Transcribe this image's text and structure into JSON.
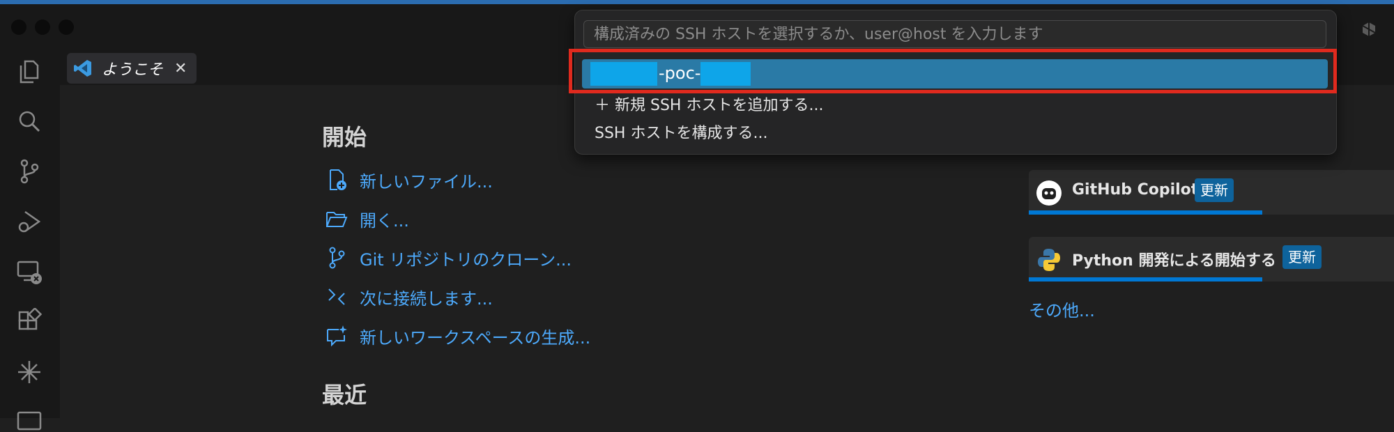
{
  "tab": {
    "label": "ようこそ",
    "close": "✕"
  },
  "quick_pick": {
    "placeholder": "構成済みの SSH ホストを選択するか、user@host を入力します",
    "selected_host": "-poc-",
    "items": [
      {
        "label": "＋ 新規 SSH ホストを追加する..."
      },
      {
        "label": "SSH ホストを構成する..."
      }
    ]
  },
  "start": {
    "title": "開始",
    "items": [
      {
        "label": "新しいファイル...",
        "icon": "new-file-icon"
      },
      {
        "label": "開く...",
        "icon": "folder-open-icon"
      },
      {
        "label": "Git リポジトリのクローン...",
        "icon": "source-control-icon"
      },
      {
        "label": "次に接続します...",
        "icon": "remote-connect-icon"
      },
      {
        "label": "新しいワークスペースの生成...",
        "icon": "chat-sparkle-icon"
      }
    ]
  },
  "recent": {
    "title": "最近"
  },
  "walkthroughs": [
    {
      "label": "GitHub Copilot",
      "badge": "更新",
      "icon": "copilot-icon",
      "progress": 0.64
    },
    {
      "label": "Python 開発による開始する",
      "badge": "更新",
      "icon": "python-icon",
      "progress": 0.64
    }
  ],
  "more": "その他...",
  "colors": {
    "accent": "#0078d4",
    "link": "#4daafc",
    "highlight_border": "#e02a1e",
    "selection": "#2a7aa6"
  }
}
